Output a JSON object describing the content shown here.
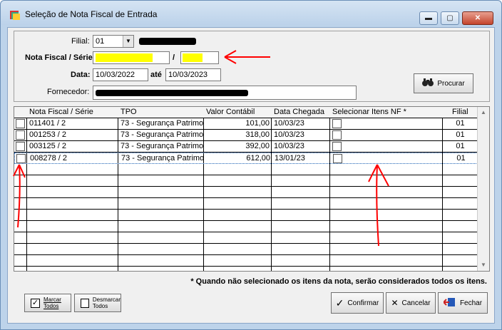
{
  "window": {
    "title": "Seleção de Nota Fiscal de Entrada",
    "minimize": "▬",
    "maximize": "▢",
    "close": "✕"
  },
  "filters": {
    "filial_label": "Filial:",
    "filial_value": "01",
    "nota_label": "Nota Fiscal / Série:",
    "serie_separator": "/",
    "data_label": "Data:",
    "data_from": "10/03/2022",
    "ate_label": "até",
    "data_to": "10/03/2023",
    "fornecedor_label": "Fornecedor:",
    "procurar_label": "Procurar"
  },
  "grid": {
    "headers": [
      "Nota Fiscal / Série",
      "TPO",
      "Valor Contábil",
      "Data Chegada",
      "Selecionar Itens NF *",
      "Filial"
    ],
    "rows": [
      {
        "nota": "011401 / 2",
        "tpo": "73 - Segurança Patrimon",
        "valor": "101,00",
        "data": "10/03/23",
        "filial": "01"
      },
      {
        "nota": "001253 / 2",
        "tpo": "73 - Segurança Patrimon",
        "valor": "318,00",
        "data": "10/03/23",
        "filial": "01"
      },
      {
        "nota": "003125 / 2",
        "tpo": "73 - Segurança Patrimon",
        "valor": "392,00",
        "data": "10/03/23",
        "filial": "01"
      },
      {
        "nota": "008278 / 2",
        "tpo": "73 - Segurança Patrimon",
        "valor": "612,00",
        "data": "13/01/23",
        "filial": "01"
      }
    ]
  },
  "note": "* Quando não selecionado os itens da nota, serão considerados todos os itens.",
  "footer": {
    "marcar_line1": "Marcar",
    "marcar_line2": "Todos",
    "desmarcar_line1": "Desmarcar",
    "desmarcar_line2": "Todos",
    "confirmar": "Confirmar",
    "cancelar": "Cancelar",
    "fechar": "Fechar"
  },
  "annotation_color": "#ff0000",
  "highlight_color": "#ffff00"
}
